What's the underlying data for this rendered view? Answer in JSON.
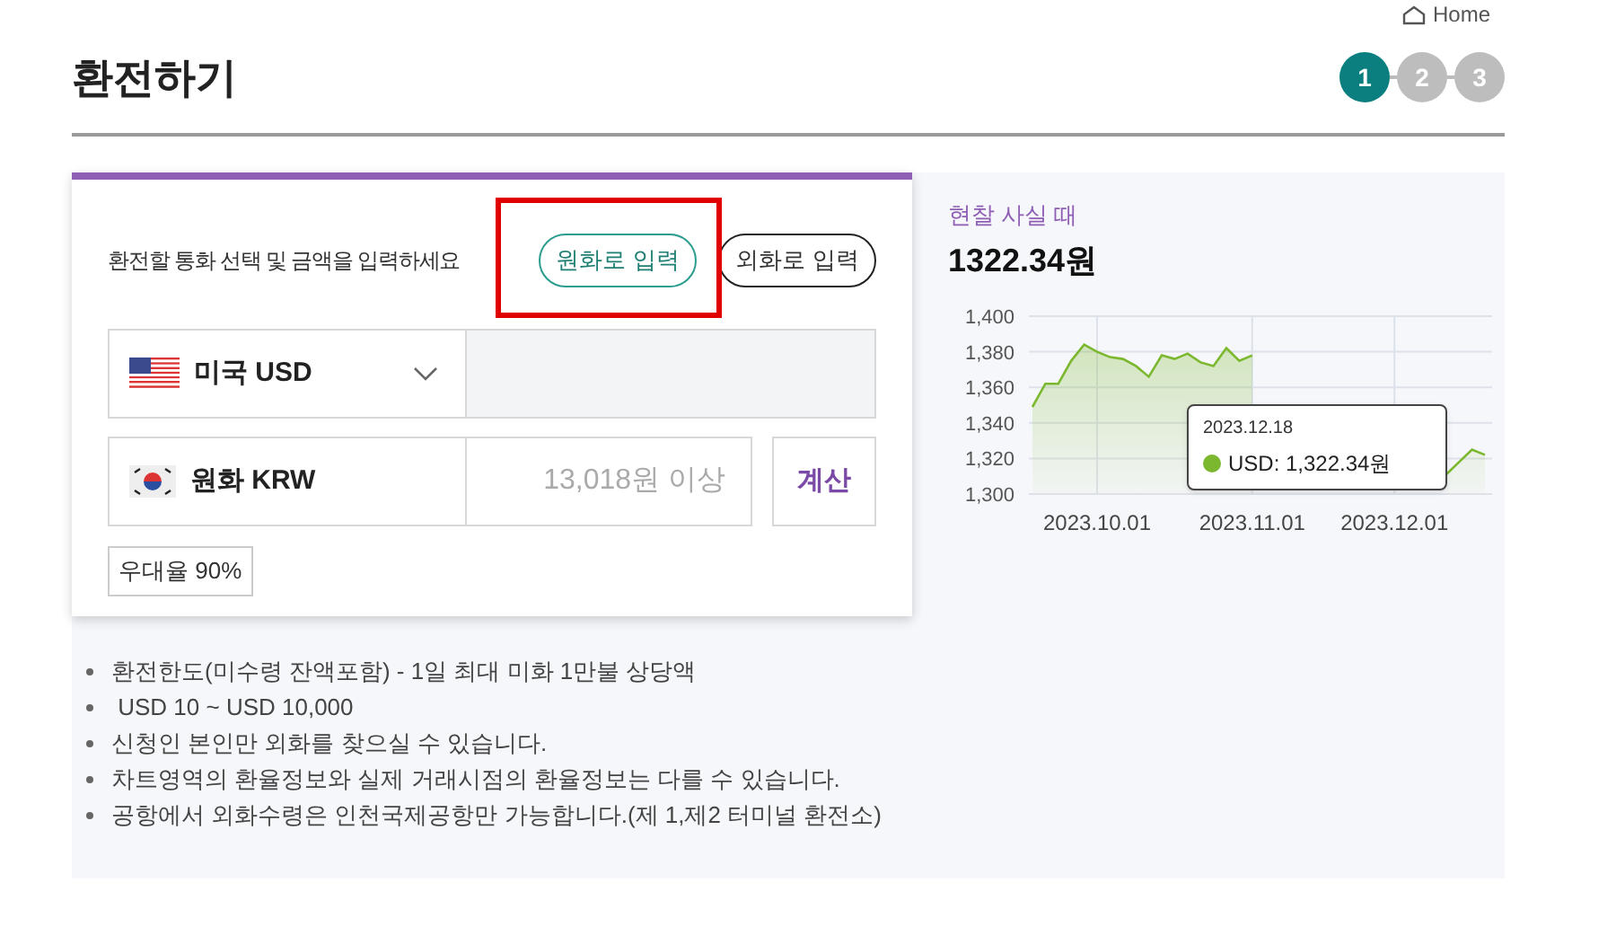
{
  "breadcrumb": {
    "home": "Home"
  },
  "page": {
    "title": "환전하기"
  },
  "steps": [
    {
      "label": "1",
      "selected": true
    },
    {
      "label": "2",
      "selected": false
    },
    {
      "label": "3",
      "selected": false
    }
  ],
  "form": {
    "instruction": "환전할 통화 선택 및 금액을 입력하세요",
    "modes": [
      {
        "label": "원화로 입력",
        "selected": true
      },
      {
        "label": "외화로 입력",
        "selected": false
      }
    ],
    "foreign": {
      "currency": "미국 USD",
      "kind": "us"
    },
    "local": {
      "currency": "원화 KRW",
      "kind": "kr",
      "placeholder": "13,018원 이상"
    },
    "calculate": "계산",
    "rate_badge": "우대율 90%"
  },
  "rate": {
    "label": "현찰 사실 때",
    "value": "1322.34원",
    "tooltip": {
      "date": "2023.12.18",
      "text": "USD: 1,322.34원",
      "color": "#7cb82f"
    },
    "chart_data": {
      "type": "area",
      "grid": true,
      "categories": [
        null,
        null,
        null,
        null,
        null,
        "2023.10.01",
        null,
        null,
        null,
        null,
        null,
        null,
        null,
        null,
        null,
        null,
        null,
        "2023.11.01",
        null,
        null,
        null,
        null,
        null,
        null,
        null,
        null,
        null,
        null,
        "2023.12.01",
        null,
        null,
        null,
        null,
        null,
        null,
        null
      ],
      "series": [
        {
          "color": "#7cb82f",
          "values": [
            1349,
            1362,
            1362,
            1375,
            1384,
            1380,
            1377,
            1376,
            1372,
            1366,
            1378,
            1376,
            1379,
            1374,
            1372,
            1382,
            1375,
            1378,
            null,
            null,
            null,
            null,
            null,
            null,
            null,
            null,
            null,
            null,
            null,
            null,
            null,
            null,
            1311,
            1318,
            1325,
            1322
          ]
        }
      ],
      "ylim": [
        1300,
        1400
      ],
      "yticks": [
        {
          "value": 1300,
          "label": "1,300"
        },
        {
          "value": 1320,
          "label": "1,320"
        },
        {
          "value": 1340,
          "label": "1,340"
        },
        {
          "value": 1360,
          "label": "1,360"
        },
        {
          "value": 1380,
          "label": "1,380"
        },
        {
          "value": 1400,
          "label": "1,400"
        }
      ]
    }
  },
  "notes": [
    "환전한도(미수령 잔액포함) - 1일 최대 미화 1만불 상당액",
    " USD 10 ~ USD 10,000",
    "신청인 본인만 외화를 찾으실 수 있습니다.",
    "차트영역의 환율정보와 실제 거래시점의 환율정보는 다를 수 있습니다.",
    "공항에서 외화수령은 인천국제공항만 가능합니다.(제 1,제2 터미널 환전소)"
  ]
}
